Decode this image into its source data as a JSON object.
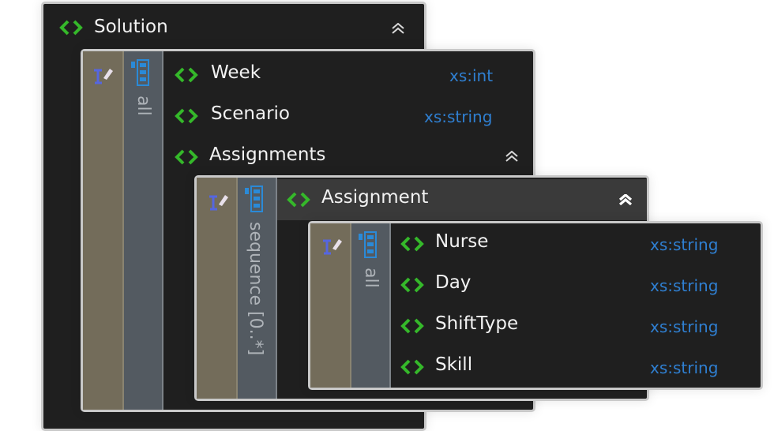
{
  "solution": {
    "name": "Solution"
  },
  "outer_group": {
    "compositor": "all",
    "items": [
      {
        "name": "Week",
        "type": "xs:int"
      },
      {
        "name": "Scenario",
        "type": "xs:string"
      },
      {
        "name": "Assignments",
        "type": ""
      }
    ]
  },
  "assignment_group": {
    "compositor": "sequence [0..*]",
    "element": "Assignment"
  },
  "inner_group": {
    "compositor": "all",
    "items": [
      {
        "name": "Nurse",
        "type": "xs:string"
      },
      {
        "name": "Day",
        "type": "xs:string"
      },
      {
        "name": "ShiftType",
        "type": "xs:string"
      },
      {
        "name": "Skill",
        "type": "xs:string"
      }
    ]
  },
  "colors": {
    "element_icon": "#35b82a",
    "type_text": "#2f7fd1",
    "compositor_icon": "#2a8ad8",
    "panel_bg": "#1f1f1f"
  }
}
